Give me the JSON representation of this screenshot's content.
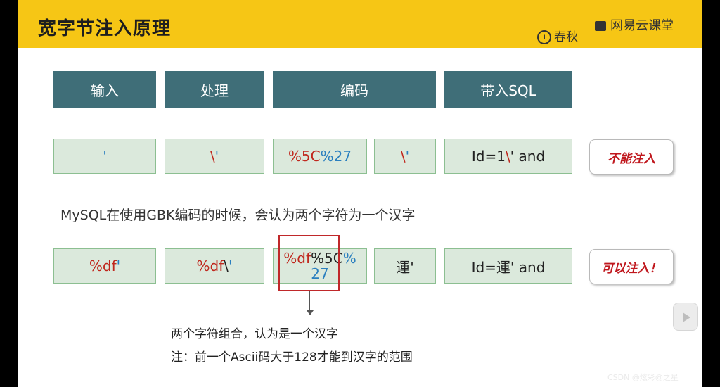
{
  "header": {
    "title": "宽字节注入原理",
    "brand_left": "春秋",
    "brand_left_logo": "i",
    "brand_right": "网易云课堂"
  },
  "table_headers": [
    "输入",
    "处理",
    "编码",
    "带入SQL"
  ],
  "row1": {
    "input": "'",
    "processing_text": "\\",
    "processing_quote": "'",
    "encoding_part1": "%5C",
    "encoding_part2": "%27",
    "decoded_text": "\\",
    "decoded_quote": "'",
    "sql_prefix": "Id=1",
    "sql_slash": "\\",
    "sql_suffix": "' and",
    "result": "不能注入"
  },
  "explanation": "MySQL在使用GBK编码的时候，会认为两个字符为一个汉字",
  "row2": {
    "input_main": "%df",
    "input_quote": "'",
    "processing_main": "%df",
    "processing_slash": "\\",
    "processing_quote": "'",
    "encoding_part1": "%df",
    "encoding_part2": "%5C",
    "encoding_part3": "%",
    "encoding_part4": "27",
    "decoded": "運'",
    "sql": "Id=運' and",
    "result": "可以注入！"
  },
  "notes": {
    "line1": "两个字符组合，认为是一个汉字",
    "line2": "注：前一个Ascii码大于128才能到汉字的范围"
  },
  "watermark": "CSDN @炫彩@之星",
  "icons": {
    "play": "play-icon",
    "brand_logo": "cloud-class-logo-icon"
  },
  "colors": {
    "header_bg": "#f6c615",
    "header_cell": "#3f6e78",
    "cell_bg": "#dbe9dc",
    "accent_red": "#c0281e",
    "accent_blue": "#2a7fbf"
  }
}
